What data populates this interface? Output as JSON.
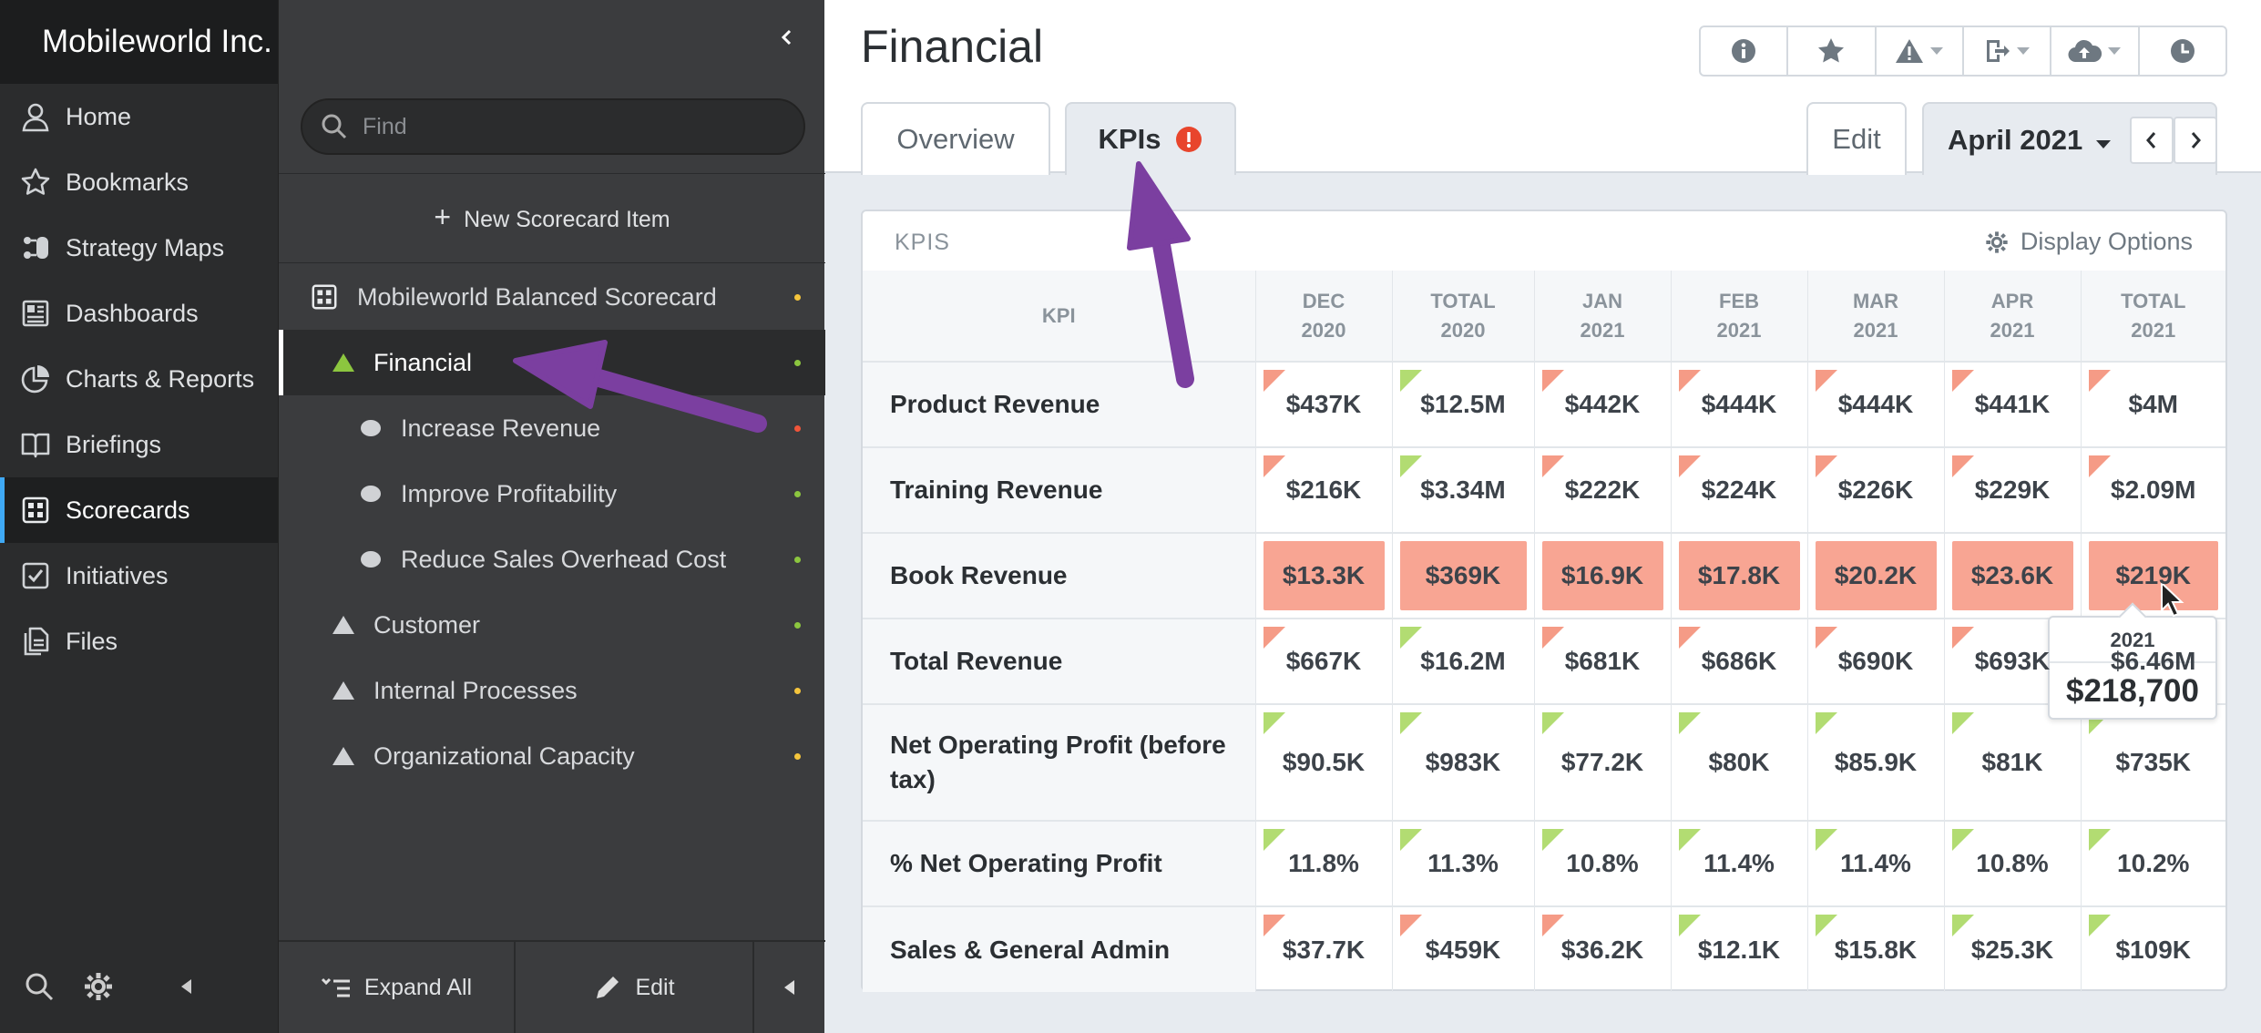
{
  "app": {
    "org_name": "Mobileworld Inc."
  },
  "nav": {
    "items": [
      {
        "label": "Home",
        "icon": "user-icon"
      },
      {
        "label": "Bookmarks",
        "icon": "star-icon"
      },
      {
        "label": "Strategy Maps",
        "icon": "strategy-map-icon"
      },
      {
        "label": "Dashboards",
        "icon": "dashboard-icon"
      },
      {
        "label": "Charts & Reports",
        "icon": "pie-chart-icon"
      },
      {
        "label": "Briefings",
        "icon": "book-icon"
      },
      {
        "label": "Scorecards",
        "icon": "scorecard-icon",
        "active": true
      },
      {
        "label": "Initiatives",
        "icon": "checkbox-icon"
      },
      {
        "label": "Files",
        "icon": "files-icon"
      }
    ]
  },
  "tree": {
    "search_placeholder": "Find",
    "new_item_label": "New Scorecard Item",
    "items": [
      {
        "label": "Mobileworld Balanced Scorecard",
        "status": "#f5c53c",
        "icon": "scorecard-icon"
      },
      {
        "label": "Financial",
        "status": "#8cc63f",
        "icon": "triangle-icon",
        "active": true
      },
      {
        "label": "Increase Revenue",
        "status": "#f0553a",
        "icon": "ellipse-icon"
      },
      {
        "label": "Improve Profitability",
        "status": "#8cc63f",
        "icon": "ellipse-icon"
      },
      {
        "label": "Reduce Sales Overhead Cost",
        "status": "#8cc63f",
        "icon": "ellipse-icon"
      },
      {
        "label": "Customer",
        "status": "#8cc63f",
        "icon": "triangle-icon"
      },
      {
        "label": "Internal Processes",
        "status": "#f5c53c",
        "icon": "triangle-icon"
      },
      {
        "label": "Organizational Capacity",
        "status": "#f5c53c",
        "icon": "triangle-icon"
      }
    ],
    "footer": {
      "expand_all": "Expand All",
      "edit": "Edit"
    }
  },
  "main": {
    "title": "Financial",
    "tabs": [
      {
        "label": "Overview"
      },
      {
        "label": "KPIs",
        "alert": true
      }
    ],
    "edit_label": "Edit",
    "period_label": "April 2021",
    "card": {
      "title": "KPIS",
      "display_options": "Display Options",
      "columns": [
        "KPI",
        "DEC\n2020",
        "TOTAL\n2020",
        "JAN\n2021",
        "FEB\n2021",
        "MAR\n2021",
        "APR\n2021",
        "TOTAL\n2021"
      ],
      "rows": [
        {
          "name": "Product Revenue",
          "cells": [
            {
              "v": "$437K",
              "s": "red"
            },
            {
              "v": "$12.5M",
              "s": "green"
            },
            {
              "v": "$442K",
              "s": "red"
            },
            {
              "v": "$444K",
              "s": "red"
            },
            {
              "v": "$444K",
              "s": "red"
            },
            {
              "v": "$441K",
              "s": "red"
            },
            {
              "v": "$4M",
              "s": "red"
            }
          ]
        },
        {
          "name": "Training Revenue",
          "cells": [
            {
              "v": "$216K",
              "s": "red"
            },
            {
              "v": "$3.34M",
              "s": "green"
            },
            {
              "v": "$222K",
              "s": "red"
            },
            {
              "v": "$224K",
              "s": "red"
            },
            {
              "v": "$226K",
              "s": "red"
            },
            {
              "v": "$229K",
              "s": "red"
            },
            {
              "v": "$2.09M",
              "s": "red"
            }
          ]
        },
        {
          "name": "Book Revenue",
          "cells": [
            {
              "v": "$13.3K",
              "s": "fill"
            },
            {
              "v": "$369K",
              "s": "fill"
            },
            {
              "v": "$16.9K",
              "s": "fill"
            },
            {
              "v": "$17.8K",
              "s": "fill"
            },
            {
              "v": "$20.2K",
              "s": "fill"
            },
            {
              "v": "$23.6K",
              "s": "fill"
            },
            {
              "v": "$219K",
              "s": "fill"
            }
          ]
        },
        {
          "name": "Total Revenue",
          "cells": [
            {
              "v": "$667K",
              "s": "red"
            },
            {
              "v": "$16.2M",
              "s": "green"
            },
            {
              "v": "$681K",
              "s": "red"
            },
            {
              "v": "$686K",
              "s": "red"
            },
            {
              "v": "$690K",
              "s": "red"
            },
            {
              "v": "$693K",
              "s": "red"
            },
            {
              "v": "$6.46M",
              "s": "red"
            }
          ]
        },
        {
          "name": "Net Operating Profit (before tax)",
          "tall": true,
          "cells": [
            {
              "v": "$90.5K",
              "s": "green"
            },
            {
              "v": "$983K",
              "s": "green"
            },
            {
              "v": "$77.2K",
              "s": "green"
            },
            {
              "v": "$80K",
              "s": "green"
            },
            {
              "v": "$85.9K",
              "s": "green"
            },
            {
              "v": "$81K",
              "s": "green"
            },
            {
              "v": "$735K",
              "s": "green"
            }
          ]
        },
        {
          "name": "% Net Operating Profit",
          "cells": [
            {
              "v": "11.8%",
              "s": "green"
            },
            {
              "v": "11.3%",
              "s": "green"
            },
            {
              "v": "10.8%",
              "s": "green"
            },
            {
              "v": "11.4%",
              "s": "green"
            },
            {
              "v": "11.4%",
              "s": "green"
            },
            {
              "v": "10.8%",
              "s": "green"
            },
            {
              "v": "10.2%",
              "s": "green"
            }
          ]
        },
        {
          "name": "Sales & General Admin",
          "cells": [
            {
              "v": "$37.7K",
              "s": "red"
            },
            {
              "v": "$459K",
              "s": "red"
            },
            {
              "v": "$36.2K",
              "s": "red"
            },
            {
              "v": "$12.1K",
              "s": "green"
            },
            {
              "v": "$15.8K",
              "s": "green"
            },
            {
              "v": "$25.3K",
              "s": "green"
            },
            {
              "v": "$109K",
              "s": "green"
            }
          ]
        }
      ]
    },
    "tooltip": {
      "year": "2021",
      "value": "$218,700"
    }
  },
  "colors": {
    "accent": "#3fa9f5",
    "annotation_arrow": "#7b3fa0",
    "alert": "#e8452c"
  }
}
